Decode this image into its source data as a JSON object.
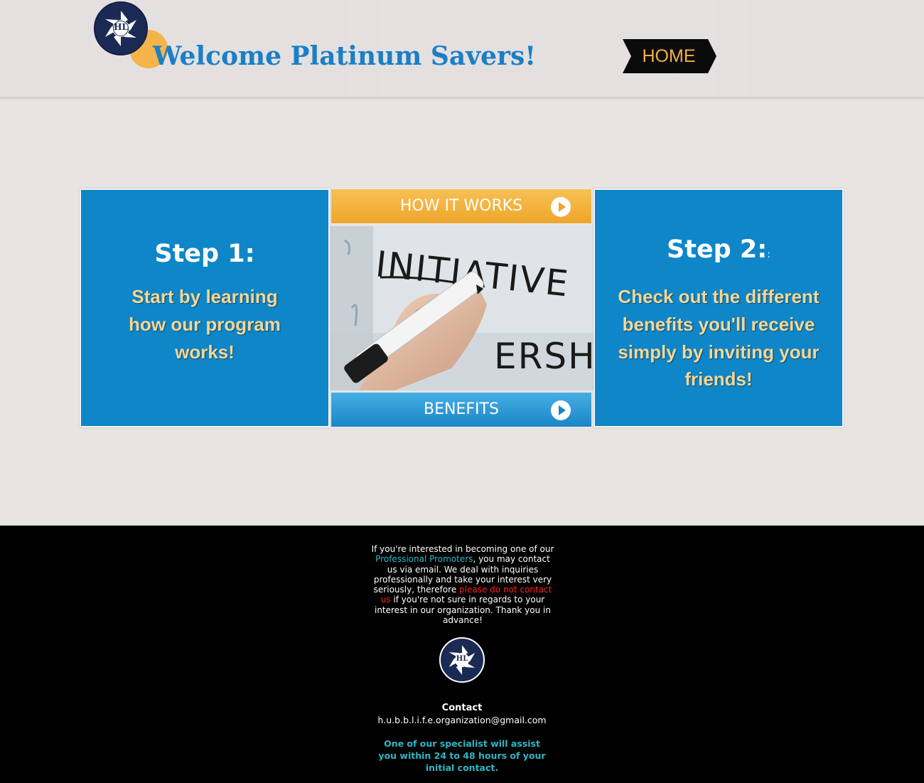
{
  "header": {
    "logo_text": "HL",
    "title": "Welcome Platinum Savers!",
    "nav_home": "HOME"
  },
  "steps": {
    "step1": {
      "title": "Step 1:",
      "lines": [
        "Start by learning",
        "how our program",
        "works!"
      ]
    },
    "step2": {
      "title": "Step 2:",
      "title_suffix": ":",
      "lines": [
        "Check out the different",
        "benefits you'll receive",
        "simply by inviting your",
        "friends!"
      ]
    }
  },
  "center": {
    "how_it_works": "HOW IT WORKS",
    "benefits": "BENEFITS",
    "image_words": [
      "INITIATIVE",
      "ERSHI"
    ]
  },
  "footer": {
    "intro_1": "If you're interested in becoming one of our",
    "promoters_link": "Professional Promoters",
    "intro_2": ", you may contact us via email.  We deal with inquiries professionally and take your interest very seriously, therefore",
    "warning": "please do not contact us",
    "intro_3": "if you're not sure in regards to your interest in our organization. Thank you in advance!",
    "logo_text": "HL",
    "contact_title": "Contact",
    "contact_email": "h.u.b.b.l.i.f.e.organization@gmail.com",
    "specialist_note": "One of our specialist will assist you within 24 to 48 hours of your initial contact."
  },
  "colors": {
    "brand_blue": "#0e86c8",
    "title_blue": "#1a7fc6",
    "accent_orange": "#f4b143",
    "step_text": "#f7d694",
    "teal": "#2fb7c6",
    "warning_red": "#ff2020"
  },
  "icons": {
    "logo": "hl-flower-logo-icon",
    "play": "play-circle-icon"
  }
}
